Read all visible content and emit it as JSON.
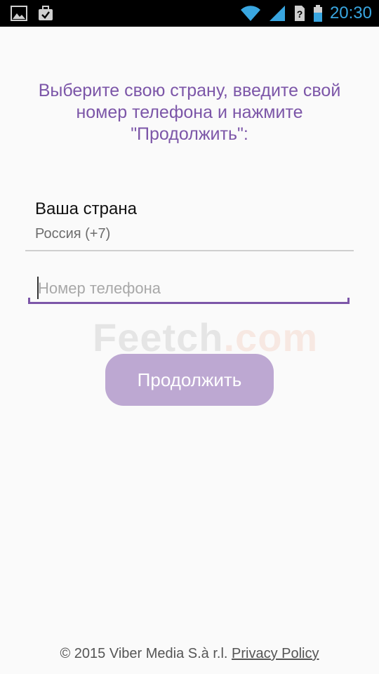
{
  "status_bar": {
    "time": "20:30",
    "icons": [
      "image-icon",
      "bag-check-icon",
      "wifi-icon",
      "signal-icon",
      "sim-unknown-icon",
      "battery-icon"
    ],
    "accent_color": "#39a6e0"
  },
  "instruction": "Выберите свою страну, введите свой номер телефона и нажмите \"Продолжить\":",
  "country": {
    "label": "Ваша страна",
    "value": "Россия (+7)"
  },
  "phone": {
    "value": "",
    "placeholder": "Номер телефона"
  },
  "watermark": {
    "part1": "Feetch",
    "part2": ".com"
  },
  "continue_label": "Продолжить",
  "footer": {
    "copyright": "© 2015 Viber Media S.à r.l.",
    "privacy_link": "Privacy Policy"
  },
  "colors": {
    "accent": "#7c56a8",
    "button_bg": "#bda8d2",
    "background": "#fafafa"
  }
}
